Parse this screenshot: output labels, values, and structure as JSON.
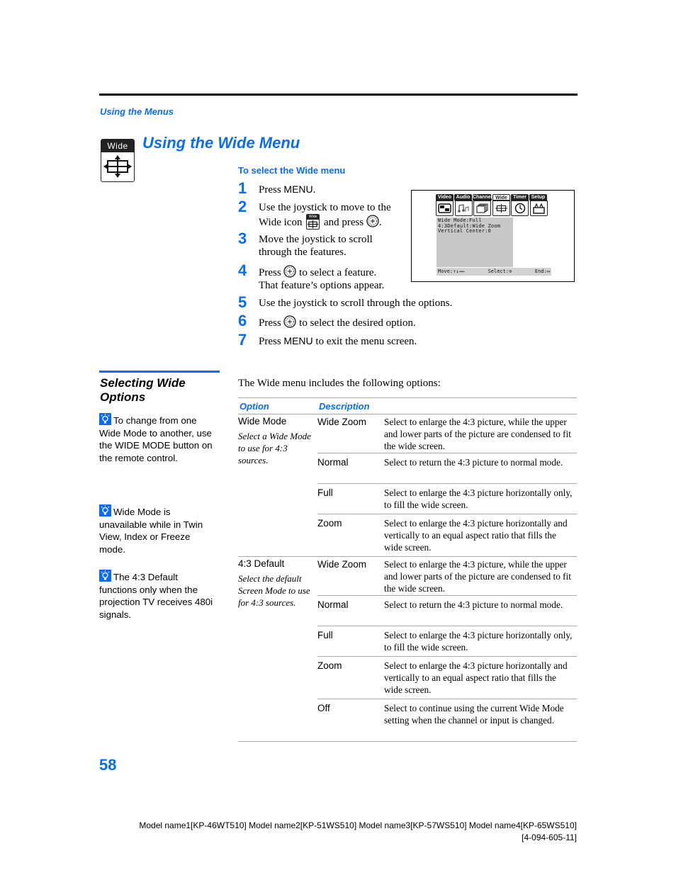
{
  "header": {
    "section_label": "Using the Menus",
    "page_title": "Using the Wide Menu",
    "badge_label": "Wide"
  },
  "colors": {
    "accent": "#0a6cf0",
    "rule": "#000000",
    "table_rule": "#aaaaaa",
    "tv_panel": "#c8c8c8"
  },
  "instructions": {
    "subhead": "To select the Wide menu",
    "steps": [
      {
        "num": "1",
        "pre": "Press ",
        "menu": "MENU",
        "post": "."
      },
      {
        "num": "2",
        "line1": "Use the joystick to move to the",
        "line2_pre": "Wide icon",
        "line2_mid": "and press",
        "line2_post": ".",
        "mini_icon_label": "Wide"
      },
      {
        "num": "3",
        "line1": "Move the joystick to scroll",
        "line2": "through the features."
      },
      {
        "num": "4",
        "pre": "Press",
        "post": "to select a feature.",
        "line2": "That feature’s options appear."
      },
      {
        "num": "5",
        "text": "Use the joystick to scroll through the options."
      },
      {
        "num": "6",
        "pre": "Press",
        "post": "to select the desired option."
      },
      {
        "num": "7",
        "pre": "Press ",
        "menu": "MENU",
        "post": " to exit the menu screen."
      }
    ]
  },
  "tv_screen": {
    "tabs": [
      "Video",
      "Audio",
      "Channel",
      "Wide",
      "Timer",
      "Setup"
    ],
    "active_tab": "Wide",
    "icons": [
      "picture-icon",
      "audio-notes-icon",
      "channel-icon",
      "wide-arrows-icon",
      "clock-icon",
      "setup-toolbox-icon"
    ],
    "panel_lines": [
      "Wide  Mode:Full",
      "4:3Default:Wide Zoom",
      "Vertical  Center:0"
    ],
    "status": {
      "move": "Move:",
      "select": "Select:",
      "end": "End:"
    }
  },
  "sidebar": {
    "title_line1": "Selecting Wide",
    "title_line2": "Options",
    "tips": [
      {
        "icon": "lightbulb-tip-icon",
        "text": "To change from one Wide Mode to another, use the WIDE MODE button on the remote control."
      },
      {
        "icon": "lightbulb-tip-icon",
        "text": "Wide Mode is unavailable while in Twin View, Index or Freeze mode."
      },
      {
        "icon": "lightbulb-tip-icon",
        "text": "The 4:3 Default functions only when the projection TV receives 480i signals."
      }
    ]
  },
  "options_table": {
    "intro": "The Wide menu includes the following options:",
    "headers": {
      "option": "Option",
      "description": "Description"
    },
    "groups": [
      {
        "name": "Wide Mode",
        "desc": "Select a Wide Mode to use for 4:3 sources.",
        "rows": [
          {
            "name": "Wide Zoom",
            "desc": "Select to enlarge the 4:3 picture, while the upper and lower parts of the picture are condensed to fit the wide screen."
          },
          {
            "name": "Normal",
            "desc": "Select to return the 4:3 picture to normal mode."
          },
          {
            "name": "Full",
            "desc": "Select to enlarge the 4:3 picture horizontally only, to fill the wide screen."
          },
          {
            "name": "Zoom",
            "desc": "Select to enlarge the 4:3 picture horizontally and vertically to an equal aspect ratio that fills the wide screen."
          }
        ]
      },
      {
        "name": "4:3 Default",
        "desc": "Select the default Screen Mode to use for 4:3 sources.",
        "rows": [
          {
            "name": "Wide Zoom",
            "desc": "Select to enlarge the 4:3 picture, while the upper and lower parts of the picture are condensed to fit the wide screen."
          },
          {
            "name": "Normal",
            "desc": "Select to return the 4:3 picture to normal mode."
          },
          {
            "name": "Full",
            "desc": "Select to enlarge the 4:3 picture horizontally only, to fill the wide screen."
          },
          {
            "name": "Zoom",
            "desc": "Select to enlarge the 4:3 picture horizontally and vertically to an equal aspect ratio that fills the wide screen."
          },
          {
            "name": "Off",
            "desc": "Select to continue using the current Wide Mode setting when the channel or input is changed."
          }
        ]
      }
    ]
  },
  "footer": {
    "page_number": "58",
    "models": "Model name1[KP-46WT510] Model name2[KP-51WS510] Model name3[KP-57WS510] Model name4[KP-65WS510]",
    "doc_number": "[4-094-605-11]"
  }
}
